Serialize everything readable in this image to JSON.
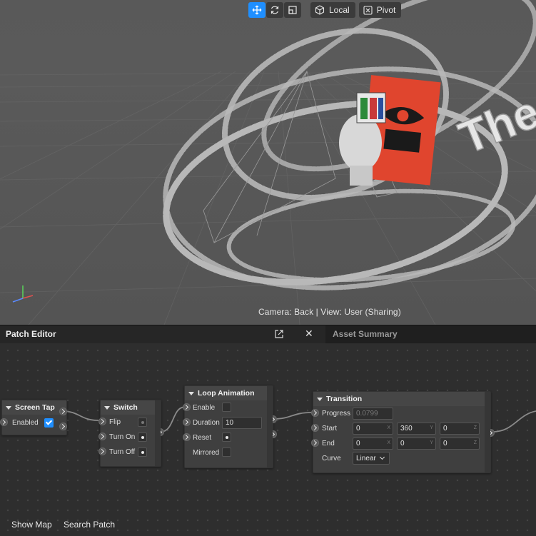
{
  "toolbar": {
    "transform_buttons": [
      {
        "icon": "move-icon",
        "active": true
      },
      {
        "icon": "rotate-icon",
        "active": false
      },
      {
        "icon": "scale-icon",
        "active": false
      }
    ],
    "space_label": "Local",
    "pivot_label": "Pivot"
  },
  "viewport": {
    "camera_status": "Camera: Back | View: User (Sharing)",
    "scene_text": "The"
  },
  "panel": {
    "active_tab": "Patch Editor",
    "inactive_tab": "Asset Summary"
  },
  "patches": {
    "screen_tap": {
      "title": "Screen Tap",
      "enabled_label": "Enabled",
      "enabled": true
    },
    "switch": {
      "title": "Switch",
      "flip_label": "Flip",
      "turn_on_label": "Turn On",
      "turn_off_label": "Turn Off"
    },
    "loop_animation": {
      "title": "Loop Animation",
      "enable_label": "Enable",
      "duration_label": "Duration",
      "duration_value": "10",
      "reset_label": "Reset",
      "mirrored_label": "Mirrored"
    },
    "transition": {
      "title": "Transition",
      "progress_label": "Progress",
      "progress_value": "0.0799",
      "start_label": "Start",
      "start_x": "0",
      "start_y": "360",
      "start_z": "0",
      "end_label": "End",
      "end_x": "0",
      "end_y": "0",
      "end_z": "0",
      "curve_label": "Curve",
      "curve_value": "Linear",
      "axis_x": "X",
      "axis_y": "Y",
      "axis_z": "Z"
    }
  },
  "footer": {
    "show_map": "Show Map",
    "search_patch": "Search Patch"
  },
  "colors": {
    "accent": "#1f8fff",
    "poster": "#e0452e"
  }
}
